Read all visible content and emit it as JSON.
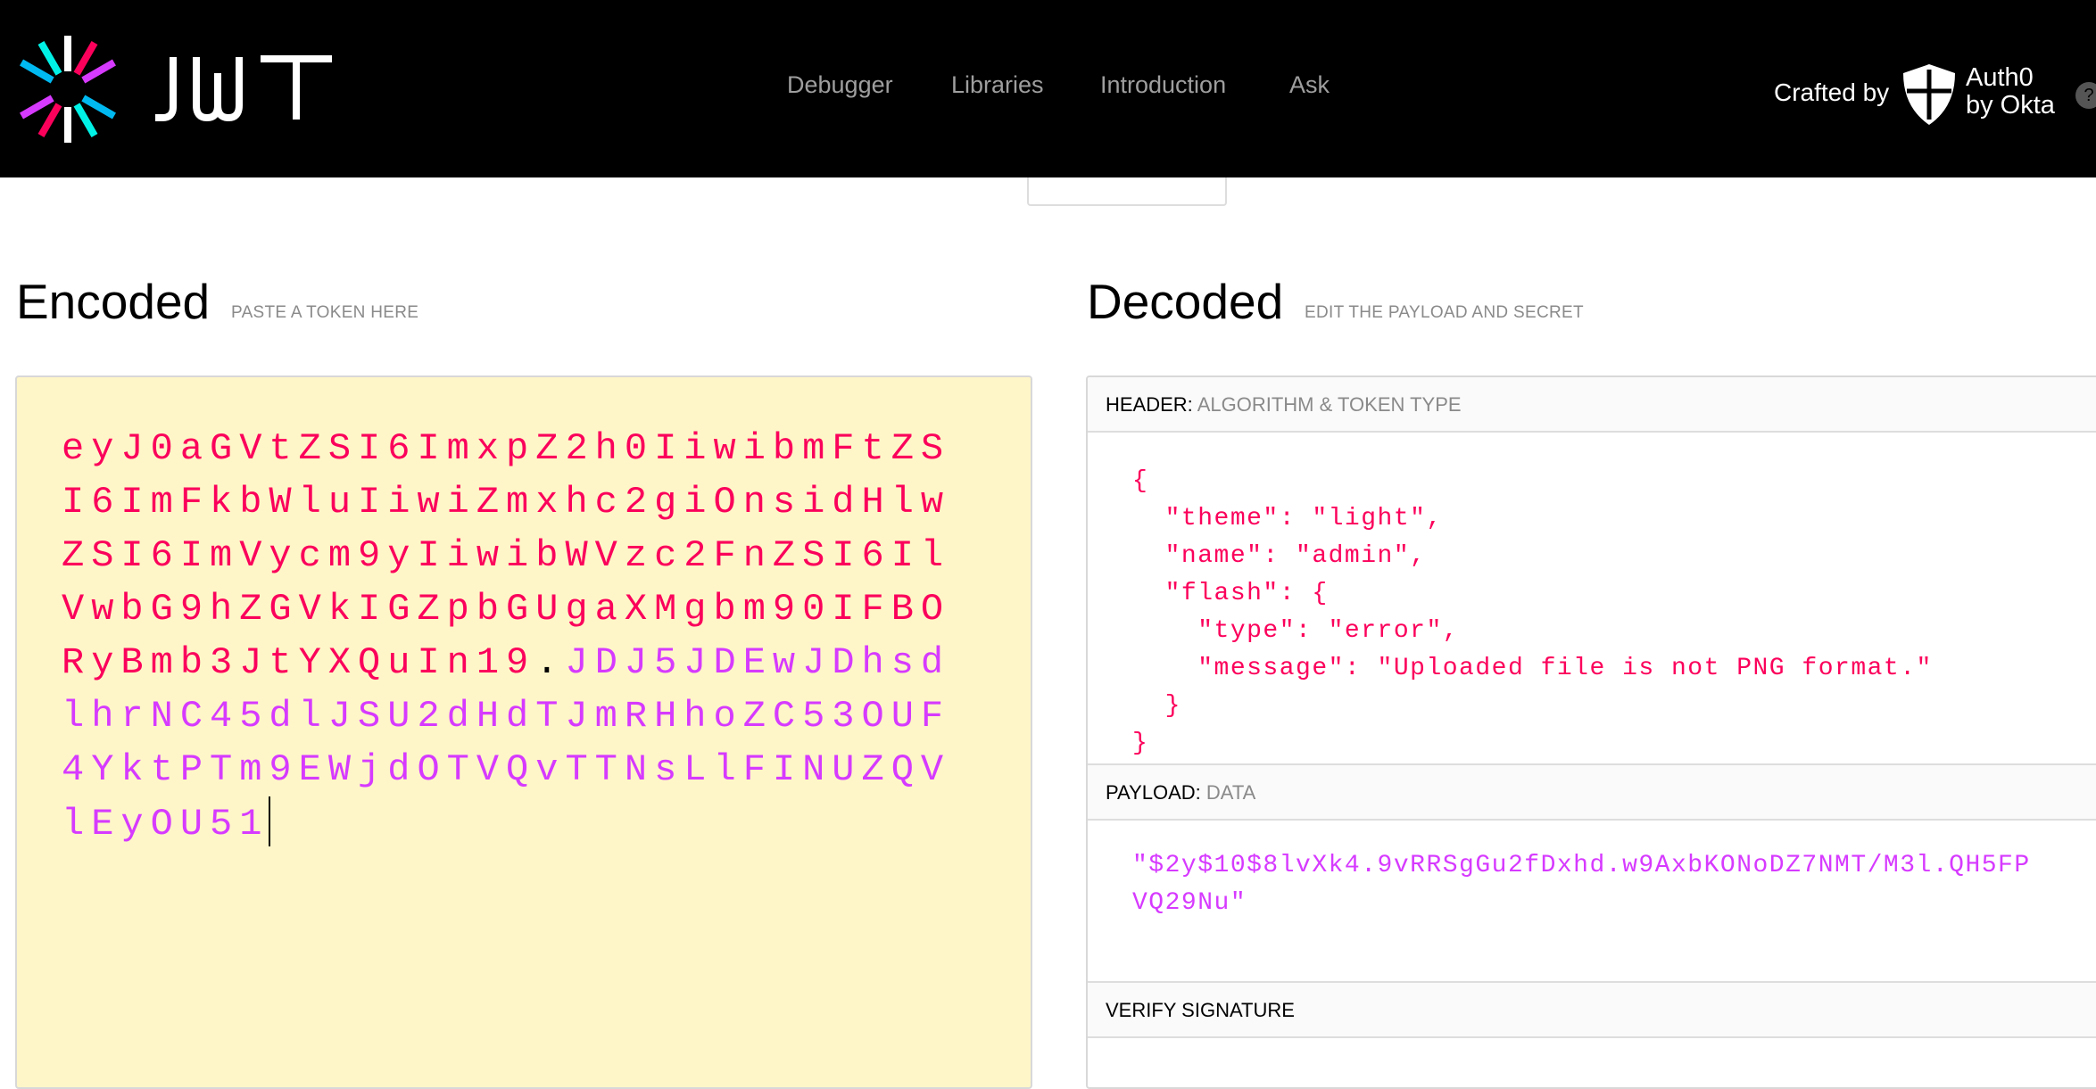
{
  "header": {
    "logo_text": "JWT",
    "nav": [
      "Debugger",
      "Libraries",
      "Introduction",
      "Ask"
    ],
    "crafted_by": "Crafted by",
    "brand_line1": "Auth0",
    "brand_line2": "by Okta",
    "help": "?"
  },
  "encoded": {
    "title": "Encoded",
    "subtitle": "PASTE A TOKEN HERE",
    "token_header_payload": "eyJ0aGVtZSI6ImxpZ2h0IiwibmFtZSI6ImFkbWluIiwiZmxhc2giOnsidHlwZSI6ImVycm9yIiwibWVzc2FnZSI6IlVwbG9hZGVkIGZpbGUgaXMgbm90IFBORyBmb3JtYXQuIn19",
    "separator": ".",
    "token_signature": "JDJ5JDEwJDhsdlhrNC45dlJSU2dHdTJmRHhoZC53OUF4YktPTm9EWjdOTVQvTTNsLlFINUZQVlEyOU51"
  },
  "decoded": {
    "title": "Decoded",
    "subtitle": "EDIT THE PAYLOAD AND SECRET",
    "header_label": "HEADER:",
    "header_type": "ALGORITHM & TOKEN TYPE",
    "header_json": "{\n  \"theme\": \"light\",\n  \"name\": \"admin\",\n  \"flash\": {\n    \"type\": \"error\",\n    \"message\": \"Uploaded file is not PNG format.\"\n  }\n}",
    "payload_label": "PAYLOAD:",
    "payload_type": "DATA",
    "payload_text": "\"$2y$10$8lvXk4.9vRRSgGu2fDxhd.w9AxbKONoDZ7NMT/M3l.QH5FP\nVQ29Nu\"",
    "verify_label": "VERIFY SIGNATURE"
  },
  "colors": {
    "header_payload": "#fb015b",
    "signature": "#d63aff",
    "encoded_bg": "#fef6c8"
  }
}
